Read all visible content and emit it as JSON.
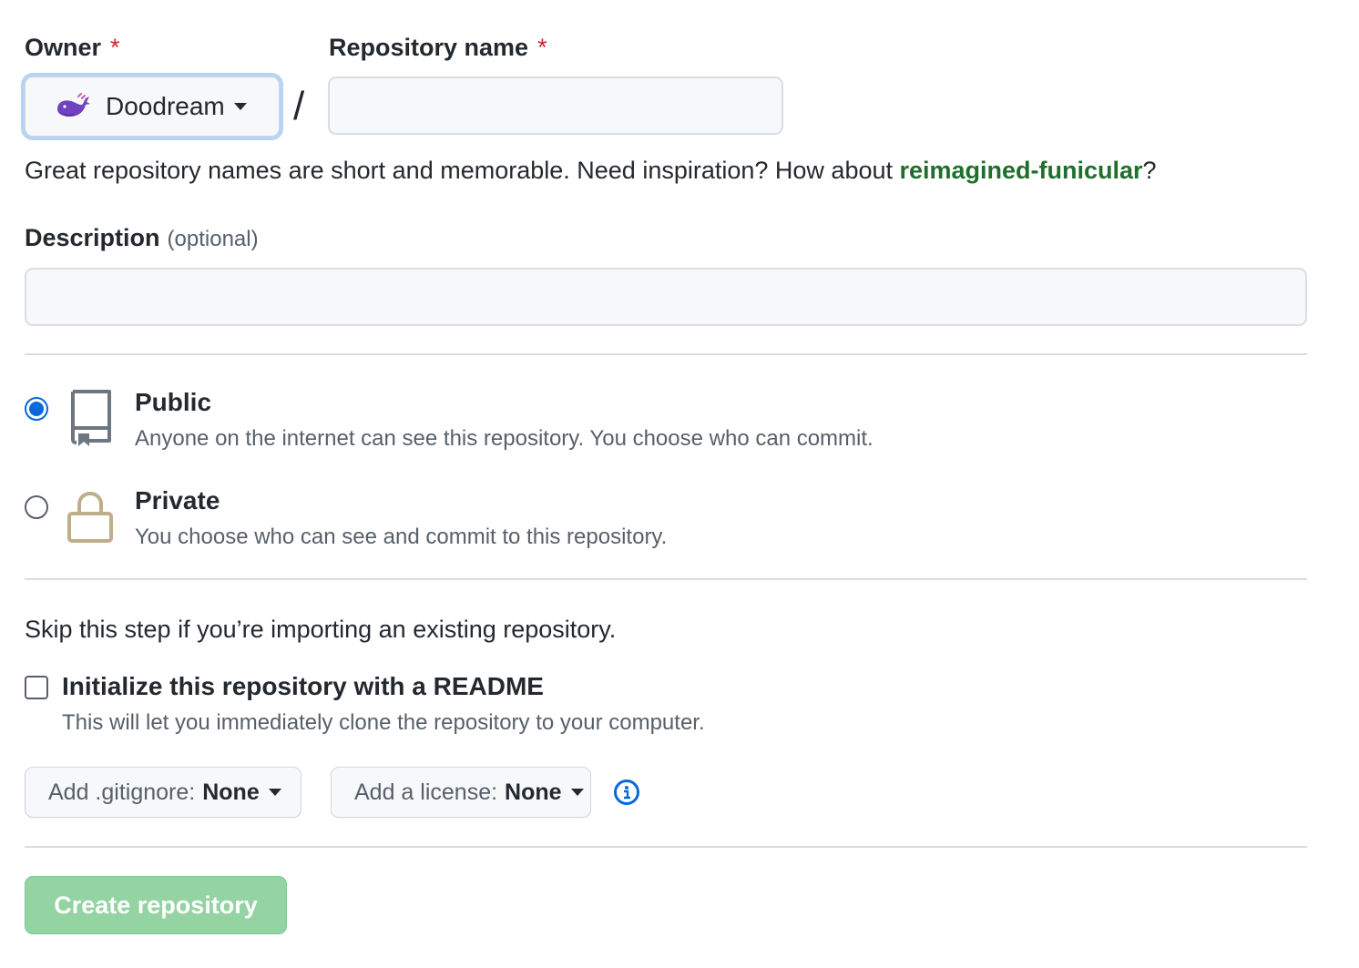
{
  "owner": {
    "label": "Owner",
    "required_mark": "*",
    "selected": "Doodream",
    "avatar_icon": "whale-avatar-icon"
  },
  "repo_name": {
    "label": "Repository name",
    "required_mark": "*",
    "separator": "/",
    "value": "",
    "placeholder": ""
  },
  "name_hint": {
    "prefix": "Great repository names are short and memorable. Need inspiration? How about ",
    "suggestion": "reimagined-funicular",
    "suffix": "?"
  },
  "description": {
    "label": "Description",
    "optional": "(optional)",
    "value": ""
  },
  "visibility": {
    "selected": "public",
    "options": [
      {
        "id": "public",
        "title": "Public",
        "desc": "Anyone on the internet can see this repository. You choose who can commit.",
        "icon": "repo-book-icon"
      },
      {
        "id": "private",
        "title": "Private",
        "desc": "You choose who can see and commit to this repository.",
        "icon": "lock-icon"
      }
    ]
  },
  "init": {
    "skip_text": "Skip this step if you’re importing an existing repository.",
    "readme_label": "Initialize this repository with a README",
    "readme_desc": "This will let you immediately clone the repository to your computer.",
    "readme_checked": false,
    "gitignore_label": "Add .gitignore:",
    "gitignore_value": "None",
    "license_label": "Add a license:",
    "license_value": "None"
  },
  "submit": {
    "label": "Create repository",
    "disabled": true
  },
  "colors": {
    "accent": "#0969da",
    "required": "#cf222e",
    "suggestion": "#1f6e2c",
    "create_disabled": "#94d3a2"
  }
}
